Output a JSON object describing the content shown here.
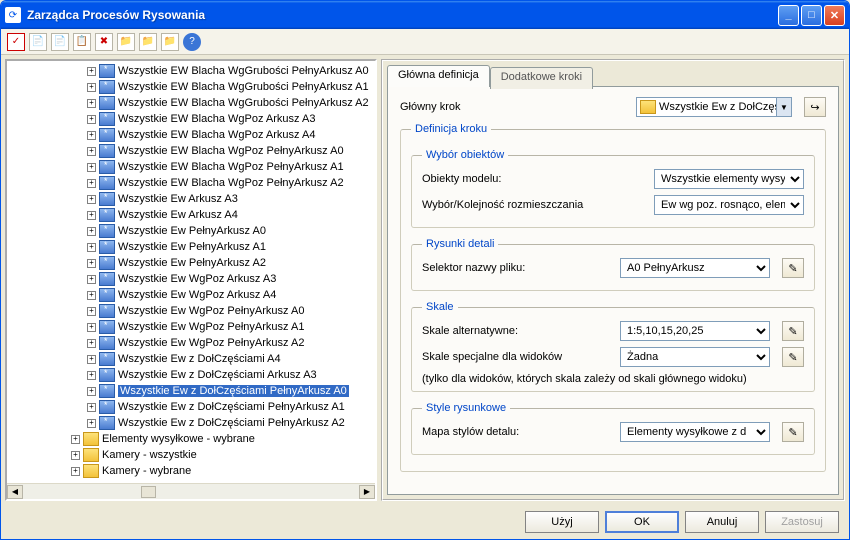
{
  "window": {
    "title": "Zarządca Procesów Rysowania"
  },
  "tree": {
    "items": [
      {
        "kind": "node",
        "label": "Wszystkie EW Blacha WgGrubości PełnyArkusz A0"
      },
      {
        "kind": "node",
        "label": "Wszystkie EW Blacha WgGrubości PełnyArkusz A1"
      },
      {
        "kind": "node",
        "label": "Wszystkie EW Blacha WgGrubości PełnyArkusz A2"
      },
      {
        "kind": "node",
        "label": "Wszystkie EW Blacha WgPoz Arkusz A3"
      },
      {
        "kind": "node",
        "label": "Wszystkie EW Blacha WgPoz Arkusz A4"
      },
      {
        "kind": "node",
        "label": "Wszystkie EW Blacha WgPoz PełnyArkusz A0"
      },
      {
        "kind": "node",
        "label": "Wszystkie EW Blacha WgPoz PełnyArkusz A1"
      },
      {
        "kind": "node",
        "label": "Wszystkie EW Blacha WgPoz PełnyArkusz A2"
      },
      {
        "kind": "node",
        "label": "Wszystkie Ew Arkusz A3"
      },
      {
        "kind": "node",
        "label": "Wszystkie Ew Arkusz A4"
      },
      {
        "kind": "node",
        "label": "Wszystkie Ew PełnyArkusz A0"
      },
      {
        "kind": "node",
        "label": "Wszystkie Ew PełnyArkusz A1"
      },
      {
        "kind": "node",
        "label": "Wszystkie Ew PełnyArkusz A2"
      },
      {
        "kind": "node",
        "label": "Wszystkie Ew WgPoz Arkusz A3"
      },
      {
        "kind": "node",
        "label": "Wszystkie Ew WgPoz Arkusz A4"
      },
      {
        "kind": "node",
        "label": "Wszystkie Ew WgPoz PełnyArkusz A0"
      },
      {
        "kind": "node",
        "label": "Wszystkie Ew WgPoz PełnyArkusz A1"
      },
      {
        "kind": "node",
        "label": "Wszystkie Ew WgPoz PełnyArkusz A2"
      },
      {
        "kind": "node",
        "label": "Wszystkie Ew z DołCzęściami A4"
      },
      {
        "kind": "node",
        "label": "Wszystkie Ew z DołCzęściami Arkusz A3"
      },
      {
        "kind": "node",
        "label": "Wszystkie Ew z DołCzęściami PełnyArkusz A0",
        "selected": true
      },
      {
        "kind": "node",
        "label": "Wszystkie Ew z DołCzęściami PełnyArkusz A1"
      },
      {
        "kind": "node",
        "label": "Wszystkie Ew z DołCzęściami PełnyArkusz A2"
      },
      {
        "kind": "folder",
        "label": "Elementy wysyłkowe - wybrane"
      },
      {
        "kind": "folder",
        "label": "Kamery - wszystkie"
      },
      {
        "kind": "folder",
        "label": "Kamery - wybrane"
      }
    ]
  },
  "tabs": {
    "main": "Główna definicja",
    "extra": "Dodatkowe kroki"
  },
  "form": {
    "mainStepLabel": "Główny krok",
    "mainStepValue": "Wszystkie Ew z DołCzęś",
    "stepDefLegend": "Definicja kroku",
    "objSelLegend": "Wybór obiektów",
    "modelObjLabel": "Obiekty modelu:",
    "modelObjValue": "Wszystkie elementy wysyłkov",
    "orderLabel": "Wybór/Kolejność rozmieszczania",
    "orderValue": "Ew wg poz. rosnąco, element",
    "detailLegend": "Rysunki detali",
    "fileSelLabel": "Selektor nazwy pliku:",
    "fileSelValue": "A0 PełnyArkusz",
    "scaleLegend": "Skale",
    "altScaleLabel": "Skale alternatywne:",
    "altScaleValue": "1:5,10,15,20,25",
    "specScaleLabel": "Skale specjalne dla widoków",
    "specScaleValue": "Żadna",
    "scaleNote": "(tylko dla widoków, których skala zależy od skali głównego widoku)",
    "styleLegend": "Style rysunkowe",
    "styleMapLabel": "Mapa stylów detalu:",
    "styleMapValue": "Elementy wysyłkowe z d"
  },
  "buttons": {
    "use": "Użyj",
    "ok": "OK",
    "cancel": "Anuluj",
    "apply": "Zastosuj"
  }
}
